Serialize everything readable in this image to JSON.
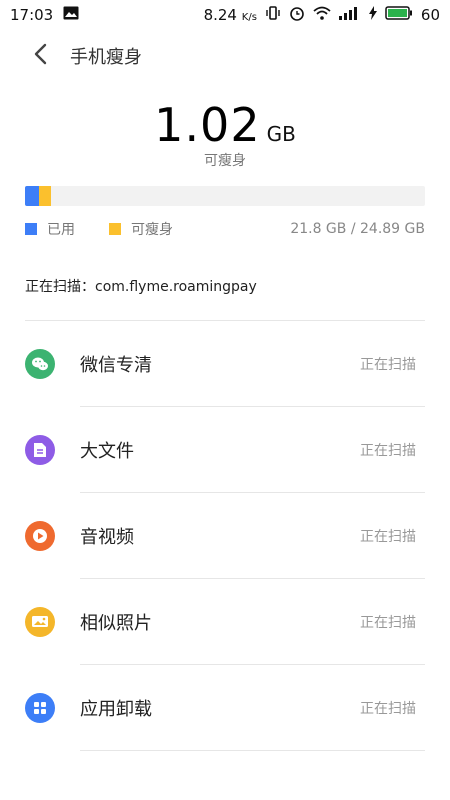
{
  "status_bar": {
    "time": "17:03",
    "speed": "8.24",
    "speed_unit": "K/s",
    "battery": "60"
  },
  "header": {
    "title": "手机瘦身"
  },
  "summary": {
    "value": "1.02",
    "unit": "GB",
    "caption": "可瘦身"
  },
  "storage": {
    "used_fraction": 0.035,
    "slimmable_fraction": 0.03,
    "legend_used": "已用",
    "legend_slimmable": "可瘦身",
    "total_text": "21.8 GB / 24.89 GB",
    "colors": {
      "used": "#3d7ef7",
      "slimmable": "#fbc02d"
    }
  },
  "scan": {
    "text": "正在扫描：com.flyme.roamingpay"
  },
  "items": [
    {
      "label": "微信专清",
      "status": "正在扫描",
      "icon": "wechat-icon",
      "color": "#3cb371"
    },
    {
      "label": "大文件",
      "status": "正在扫描",
      "icon": "document-icon",
      "color": "#8e5ce6"
    },
    {
      "label": "音视频",
      "status": "正在扫描",
      "icon": "play-icon",
      "color": "#ef6a2f"
    },
    {
      "label": "相似照片",
      "status": "正在扫描",
      "icon": "photo-icon",
      "color": "#f4b62a"
    },
    {
      "label": "应用卸载",
      "status": "正在扫描",
      "icon": "apps-grid-icon",
      "color": "#3d7ef7"
    }
  ]
}
